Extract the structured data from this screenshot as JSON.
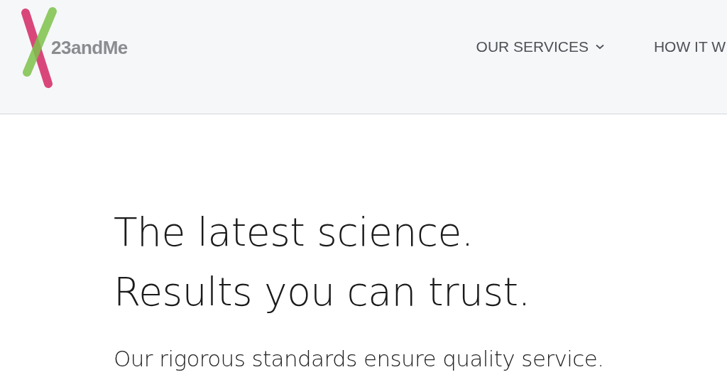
{
  "header": {
    "logo_text": "23andMe",
    "nav": [
      {
        "label": "OUR SERVICES",
        "kind": "dropdown"
      },
      {
        "label": "HOW IT W",
        "kind": "link"
      }
    ]
  },
  "hero": {
    "headline": [
      "The latest science.",
      "Results you can trust."
    ],
    "subtitle": "Our rigorous standards ensure quality service."
  }
}
